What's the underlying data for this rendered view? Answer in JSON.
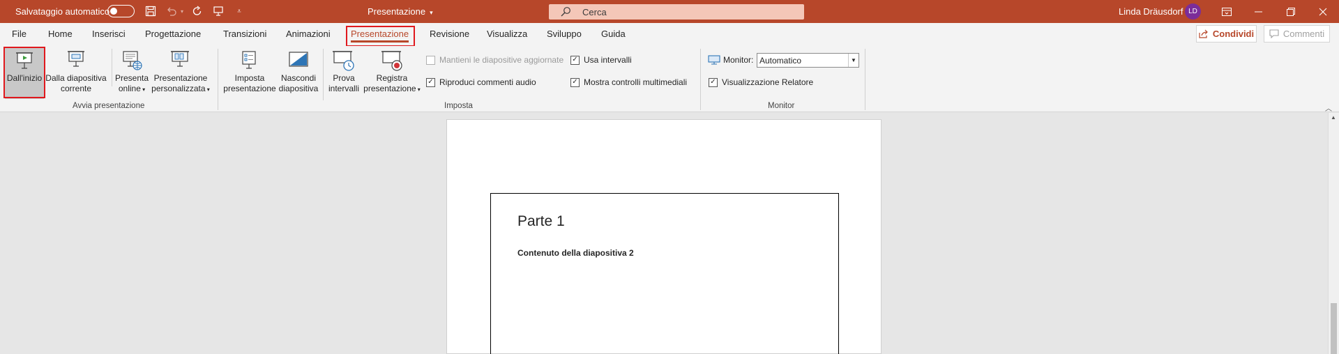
{
  "titlebar": {
    "autosave_label": "Salvataggio automatico",
    "title": "Presentazione",
    "search_placeholder": "Cerca",
    "user_name": "Linda Dräusdorf",
    "user_initials": "LD"
  },
  "tabs": [
    "File",
    "Home",
    "Inserisci",
    "Progettazione",
    "Transizioni",
    "Animazioni",
    "Presentazione",
    "Revisione",
    "Visualizza",
    "Sviluppo",
    "Guida"
  ],
  "active_tab": "Presentazione",
  "share": {
    "share_label": "Condividi",
    "comments_label": "Commenti"
  },
  "ribbon": {
    "avvia": {
      "group_label": "Avvia presentazione",
      "from_start": "Dall'inizio",
      "from_current_1": "Dalla diapositiva",
      "from_current_2": "corrente",
      "online_1": "Presenta",
      "online_2": "online",
      "custom_1": "Presentazione",
      "custom_2": "personalizzata"
    },
    "imposta": {
      "group_label": "Imposta",
      "setup_1": "Imposta",
      "setup_2": "presentazione",
      "hide_1": "Nascondi",
      "hide_2": "diapositiva",
      "rehearse_1": "Prova",
      "rehearse_2": "intervalli",
      "record_1": "Registra",
      "record_2": "presentazione",
      "keep_updated": "Mantieni le diapositive aggiornate",
      "play_narrations": "Riproduci commenti audio",
      "use_timings": "Usa intervalli",
      "show_media_controls": "Mostra controlli multimediali"
    },
    "monitor": {
      "group_label": "Monitor",
      "monitor_label": "Monitor:",
      "monitor_value": "Automatico",
      "presenter_view": "Visualizzazione Relatore"
    }
  },
  "slide": {
    "title": "Parte 1",
    "body": "Contenuto della diapositiva 2"
  },
  "colors": {
    "accent": "#b7472a",
    "highlight": "#e0181d"
  }
}
